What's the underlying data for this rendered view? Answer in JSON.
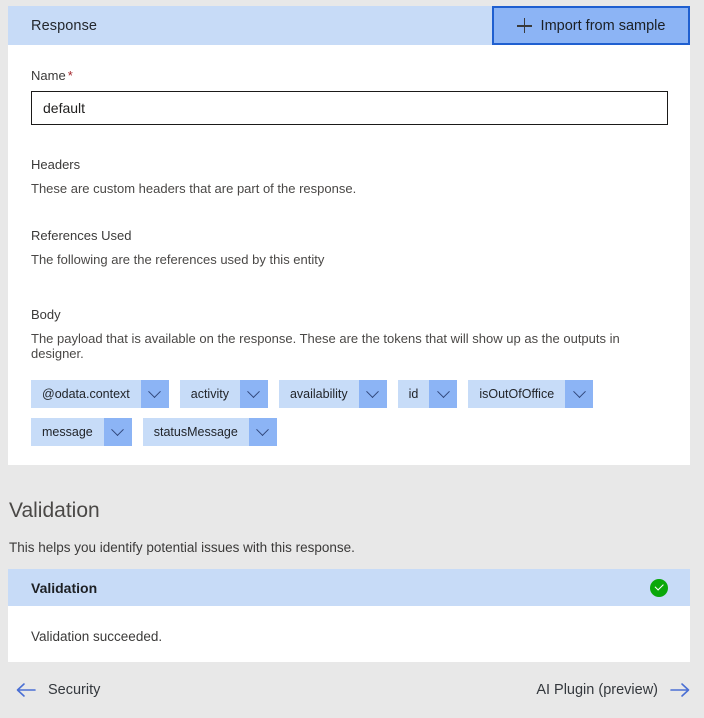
{
  "response_section": {
    "header_title": "Response",
    "import_button": {
      "label": "Import from sample",
      "icon": "plus-icon"
    },
    "name_field": {
      "label": "Name",
      "required_marker": "*",
      "value": "default",
      "placeholder": ""
    },
    "headers": {
      "title": "Headers",
      "description": "These are custom headers that are part of the response."
    },
    "references": {
      "title": "References Used",
      "description": "The following are the references used by this entity"
    },
    "body": {
      "title": "Body",
      "description": "The payload that is available on the response. These are the tokens that will show up as the outputs in designer.",
      "tokens": [
        {
          "label": "@odata.context"
        },
        {
          "label": "activity"
        },
        {
          "label": "availability"
        },
        {
          "label": "id"
        },
        {
          "label": "isOutOfOffice"
        },
        {
          "label": "message"
        },
        {
          "label": "statusMessage"
        }
      ]
    }
  },
  "validation_section": {
    "heading": "Validation",
    "description": "This helps you identify potential issues with this response.",
    "panel": {
      "title": "Validation",
      "status_icon": "check-circle-icon",
      "status": "succeeded",
      "message": "Validation succeeded."
    }
  },
  "footer": {
    "previous": {
      "label": "Security",
      "icon": "arrow-left-icon"
    },
    "next": {
      "label": "AI Plugin (preview)",
      "icon": "arrow-right-icon"
    }
  },
  "colors": {
    "accent_header_band": "#c7dbf7",
    "button_fill": "#8cb4f5",
    "button_border": "#1f5fd0",
    "chip_body": "#c7dcf8",
    "chip_caret": "#8cb4f5",
    "success_green": "#0aa80a",
    "link_blue": "#4a6fd4",
    "page_background": "#e8e8e8",
    "required_red": "#a4262c"
  }
}
